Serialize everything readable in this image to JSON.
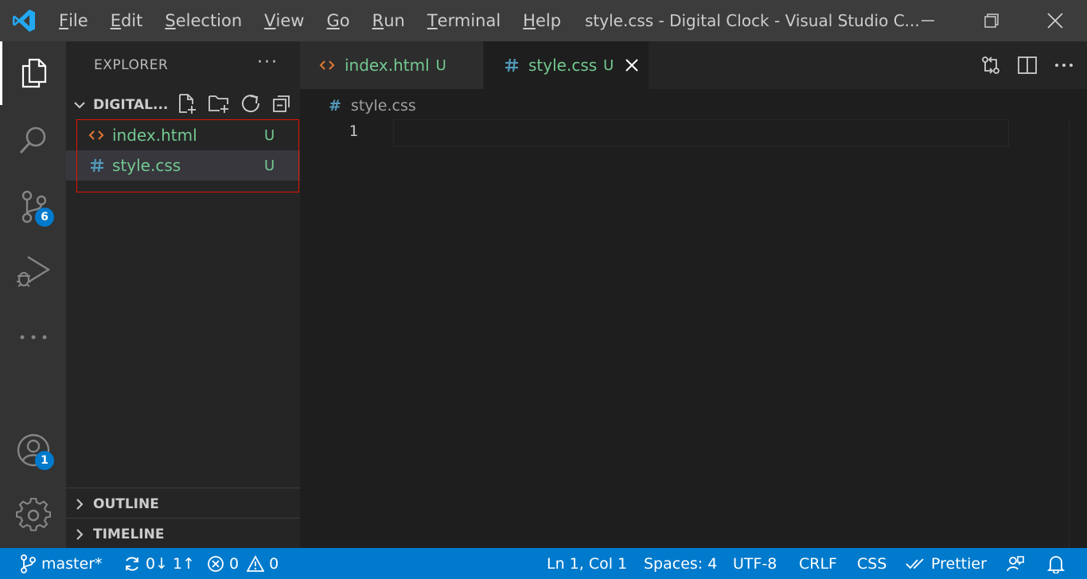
{
  "titlebar": {
    "menu": [
      {
        "mnemonic": "F",
        "rest": "ile"
      },
      {
        "mnemonic": "E",
        "rest": "dit"
      },
      {
        "mnemonic": "S",
        "rest": "election"
      },
      {
        "mnemonic": "V",
        "rest": "iew"
      },
      {
        "mnemonic": "G",
        "rest": "o"
      },
      {
        "mnemonic": "R",
        "rest": "un"
      },
      {
        "mnemonic": "T",
        "rest": "erminal"
      },
      {
        "mnemonic": "H",
        "rest": "elp"
      }
    ],
    "window_title": "style.css - Digital Clock - Visual Studio C..."
  },
  "activitybar": {
    "icons": [
      "explorer-icon",
      "search-icon",
      "source-control-icon",
      "run-debug-icon",
      "more-icon",
      "accounts-icon",
      "gear-icon"
    ],
    "source_control_badge": "6",
    "accounts_badge": "1"
  },
  "sidebar": {
    "title": "EXPLORER",
    "more": "···",
    "folder": "DIGITAL...",
    "files": [
      {
        "icon": "html-file-icon",
        "name": "index.html",
        "status": "U"
      },
      {
        "icon": "css-file-icon",
        "name": "style.css",
        "status": "U"
      }
    ],
    "outline": "OUTLINE",
    "timeline": "TIMELINE"
  },
  "tabs": [
    {
      "icon": "html-file-icon",
      "name": "index.html",
      "status": "U"
    },
    {
      "icon": "css-file-icon",
      "name": "style.css",
      "status": "U"
    }
  ],
  "editor": {
    "breadcrumb": "style.css",
    "hash": "#",
    "line_number": "1"
  },
  "statusbar": {
    "branch": "master*",
    "sync": "0↓ 1↑",
    "errors": "0",
    "warnings": "0",
    "position": "Ln 1, Col 1",
    "spaces": "Spaces: 4",
    "encoding": "UTF-8",
    "eol": "CRLF",
    "language": "CSS",
    "prettier": "Prettier"
  },
  "colors": {
    "accent": "#007acc",
    "untracked": "#73c991",
    "html": "#e37933",
    "css": "#519aba",
    "highlight": "#e51400"
  }
}
